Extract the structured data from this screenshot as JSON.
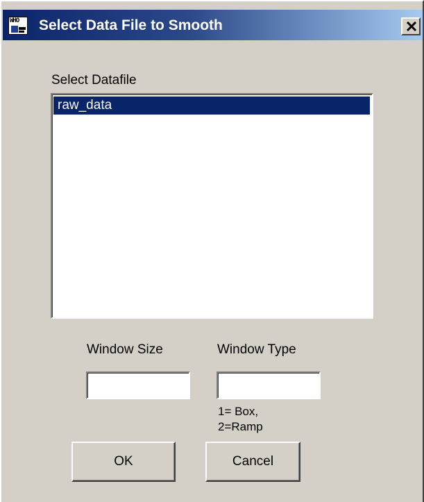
{
  "window": {
    "title": "Select Data File to Smooth",
    "app_icon": {
      "name": "app-icon",
      "text": "WHO"
    },
    "close_icon": "close-icon"
  },
  "datafile": {
    "label": "Select Datafile",
    "items": [
      {
        "label": "raw_data",
        "selected": true
      }
    ]
  },
  "window_size": {
    "label": "Window Size",
    "value": ""
  },
  "window_type": {
    "label": "Window Type",
    "value": "",
    "hint_line1": "1= Box,",
    "hint_line2": "2=Ramp"
  },
  "buttons": {
    "ok_label": "OK",
    "cancel_label": "Cancel"
  },
  "colors": {
    "titlebar_start": "#0a246a",
    "titlebar_end": "#a6caf0",
    "dialog_face": "#d4d0c8",
    "selection": "#0a246a"
  }
}
